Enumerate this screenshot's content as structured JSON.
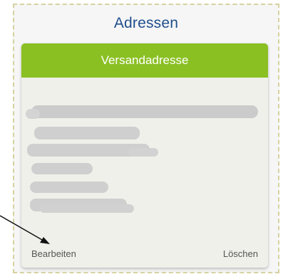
{
  "section": {
    "title": "Adressen"
  },
  "card": {
    "header": "Versandadresse",
    "edit_label": "Bearbeiten",
    "delete_label": "Löschen"
  },
  "colors": {
    "title": "#1f4e8c",
    "header_bg": "#8bc023",
    "card_bg": "#f0f0ea",
    "redaction": "#cfcfcf"
  }
}
